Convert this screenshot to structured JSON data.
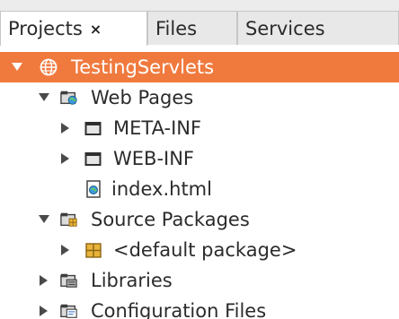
{
  "tabs": [
    {
      "label": "Projects",
      "close": "×",
      "active": true
    },
    {
      "label": "Files",
      "active": false
    },
    {
      "label": "Services",
      "active": false
    }
  ],
  "tree": {
    "project": {
      "label": "TestingServlets",
      "icon": "globe-icon"
    },
    "web_pages": {
      "label": "Web Pages",
      "icon": "web-folder-icon"
    },
    "meta_inf": {
      "label": "META-INF",
      "icon": "folder-icon"
    },
    "web_inf": {
      "label": "WEB-INF",
      "icon": "folder-icon"
    },
    "index_html": {
      "label": "index.html",
      "icon": "html-file-icon"
    },
    "source_packages": {
      "label": "Source Packages",
      "icon": "source-folder-icon"
    },
    "default_package": {
      "label": "<default package>",
      "icon": "package-icon"
    },
    "libraries": {
      "label": "Libraries",
      "icon": "library-icon"
    },
    "configuration_files": {
      "label": "Configuration Files",
      "icon": "config-icon"
    }
  },
  "colors": {
    "selection": "#f07a3e",
    "package": "#e8b33a"
  }
}
